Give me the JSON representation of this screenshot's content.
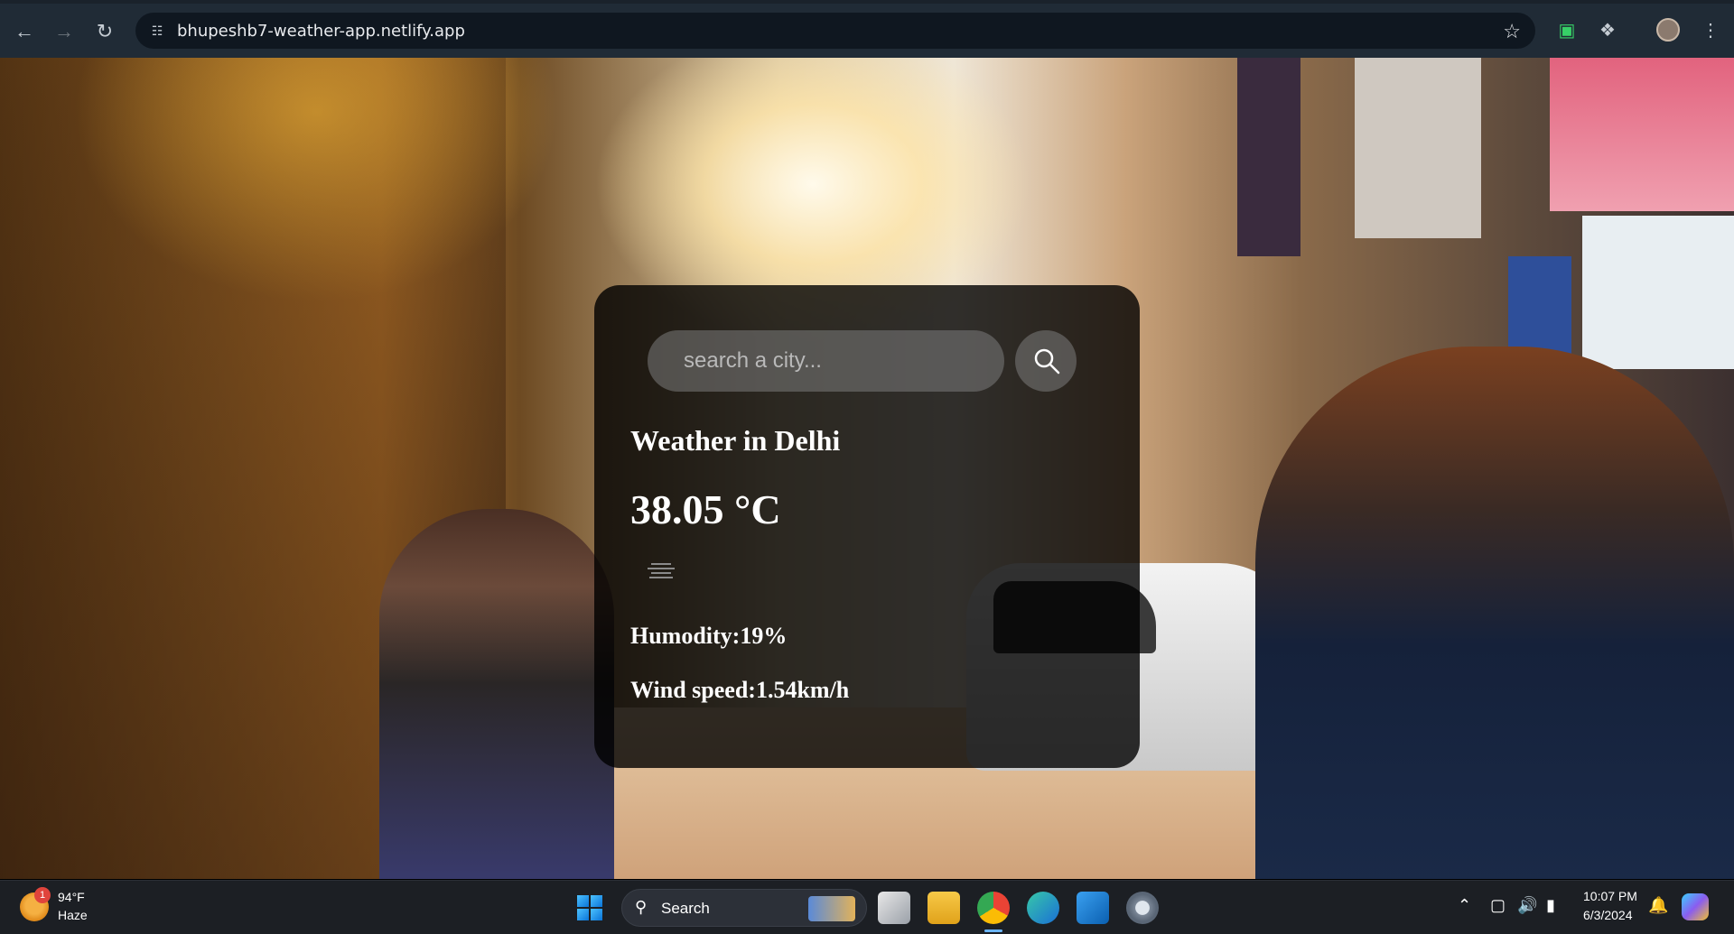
{
  "browser": {
    "url": "bhupeshb7-weather-app.netlify.app"
  },
  "weather_card": {
    "search_placeholder": "search a city...",
    "city_heading": "Weather in Delhi",
    "temperature": "38.05 °C",
    "humidity": "Humodity:19%",
    "wind": "Wind speed:1.54km/h"
  },
  "taskbar": {
    "weather_badge": "1",
    "weather_temp": "94°F",
    "weather_condition": "Haze",
    "search_label": "Search",
    "time": "10:07 PM",
    "date": "6/3/2024"
  }
}
